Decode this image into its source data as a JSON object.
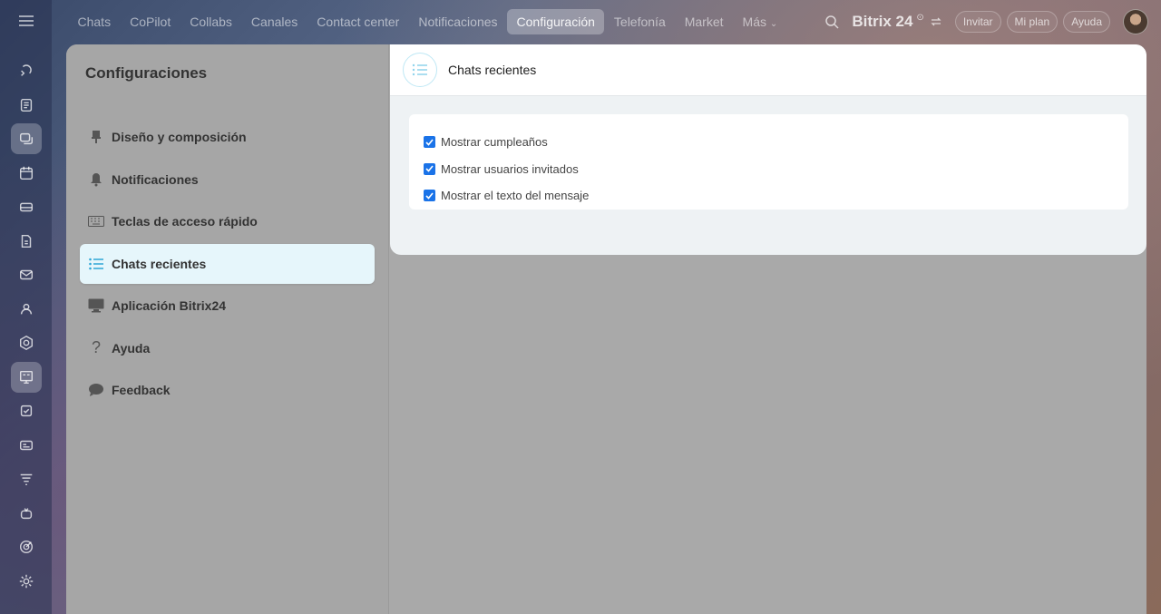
{
  "topnav": {
    "items": [
      {
        "label": "Chats",
        "active": false
      },
      {
        "label": "CoPilot",
        "active": false
      },
      {
        "label": "Collabs",
        "active": false
      },
      {
        "label": "Canales",
        "active": false
      },
      {
        "label": "Contact center",
        "active": false
      },
      {
        "label": "Notificaciones",
        "active": false
      },
      {
        "label": "Configuración",
        "active": true
      },
      {
        "label": "Telefonía",
        "active": false
      },
      {
        "label": "Market",
        "active": false
      },
      {
        "label": "Más",
        "active": false
      }
    ],
    "brand": "Bitrix 24",
    "brand_sup": "⊙",
    "invite_label": "Invitar",
    "plan_label": "Mi plan",
    "help_label": "Ayuda"
  },
  "rail": {
    "icons": [
      "copilot-icon",
      "feed-icon",
      "chat-icon",
      "calendar-icon",
      "drive-icon",
      "docs-icon",
      "mail-icon",
      "contacts-icon",
      "crm-icon",
      "board-icon",
      "tasks-icon",
      "sites-icon",
      "filter-icon",
      "robot-icon",
      "target-icon",
      "settings-icon"
    ],
    "active_index": 2
  },
  "settings": {
    "title": "Configuraciones",
    "menu": [
      {
        "label": "Diseño y composición",
        "icon": "brush-icon",
        "active": false
      },
      {
        "label": "Notificaciones",
        "icon": "bell-icon",
        "active": false
      },
      {
        "label": "Teclas de acceso rápido",
        "icon": "keyboard-icon",
        "active": false
      },
      {
        "label": "Chats recientes",
        "icon": "list-icon",
        "active": true
      },
      {
        "label": "Aplicación Bitrix24",
        "icon": "monitor-icon",
        "active": false
      },
      {
        "label": "Ayuda",
        "icon": "question-icon",
        "active": false
      },
      {
        "label": "Feedback",
        "icon": "speech-bubble-icon",
        "active": false
      }
    ]
  },
  "panel": {
    "title": "Chats recientes",
    "options": [
      {
        "label": "Mostrar cumpleaños",
        "checked": true
      },
      {
        "label": "Mostrar usuarios invitados",
        "checked": true
      },
      {
        "label": "Mostrar el texto del mensaje",
        "checked": true
      }
    ]
  },
  "colors": {
    "accent": "#2fa6d6",
    "checkbox": "#1a73e8"
  }
}
